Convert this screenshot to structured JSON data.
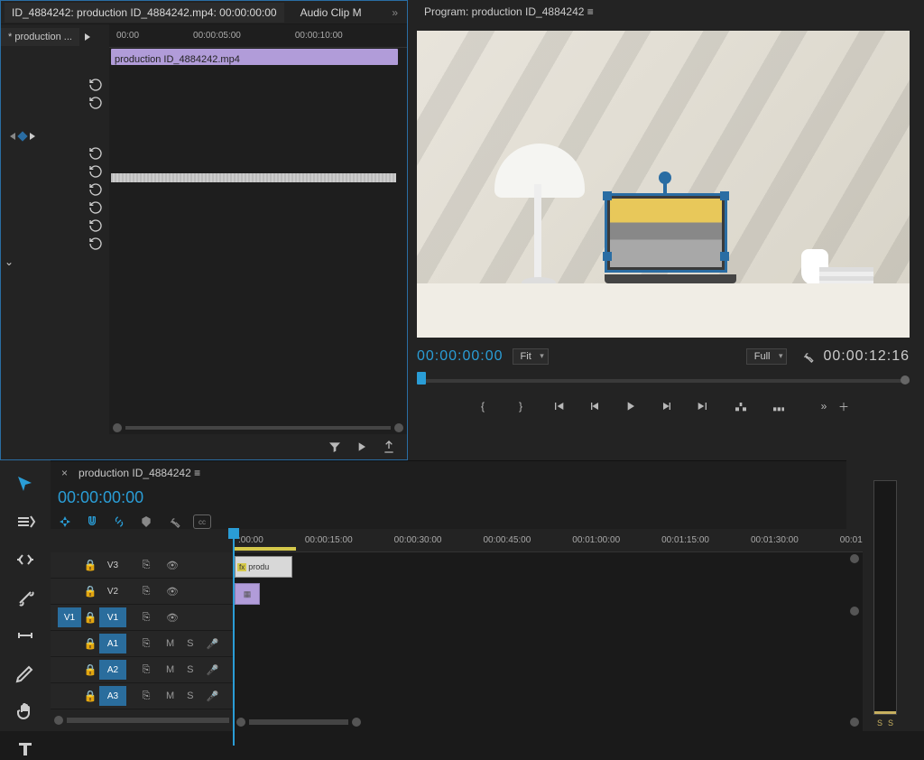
{
  "source": {
    "tab_title": "ID_4884242: production ID_4884242.mp4: 00:00:00:00",
    "tab2": "Audio Clip M",
    "sub_tab": "* production ...",
    "ruler": [
      "00:00",
      "00:00:05:00",
      "00:00:10:00"
    ],
    "clip_label": "production ID_4884242.mp4"
  },
  "program": {
    "header": "Program: production ID_4884242  ≡",
    "tc_left": "00:00:00:00",
    "zoom": "Fit",
    "resolution": "Full",
    "tc_right": "00:00:12:16"
  },
  "timeline": {
    "title": "production ID_4884242  ≡",
    "tc": "00:00:00:00",
    "ruler": [
      ":00:00",
      "00:00:15:00",
      "00:00:30:00",
      "00:00:45:00",
      "00:01:00:00",
      "00:01:15:00",
      "00:01:30:00",
      "00:01"
    ],
    "clip_v2": "produ",
    "tracks": {
      "video": [
        {
          "src": "",
          "name": "V3"
        },
        {
          "src": "",
          "name": "V2"
        },
        {
          "src": "V1",
          "name": "V1"
        }
      ],
      "audio": [
        {
          "src": "",
          "name": "A1"
        },
        {
          "src": "",
          "name": "A2"
        },
        {
          "src": "",
          "name": "A3"
        }
      ]
    },
    "audio_toggles": {
      "m": "M",
      "s": "S"
    }
  },
  "meters": {
    "l": "S",
    "r": "S"
  }
}
